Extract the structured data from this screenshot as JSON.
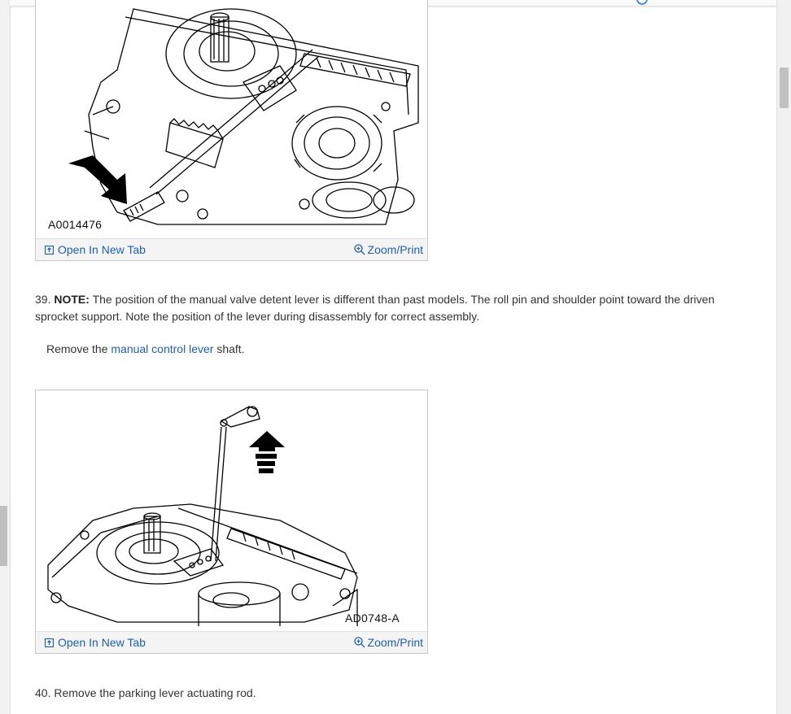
{
  "figures": [
    {
      "label": "A0014476",
      "open_link": "Open In New Tab",
      "zoom_link": "Zoom/Print"
    },
    {
      "label": "AD0748-A",
      "open_link": "Open In New Tab",
      "zoom_link": "Zoom/Print"
    }
  ],
  "step39": {
    "number": "39.",
    "note_label": "NOTE:",
    "note_text": "The position of the manual valve detent lever is different than past models. The roll pin and shoulder point toward the driven sprocket support. Note the position of the lever during disassembly for correct assembly.",
    "remove_prefix": "Remove the",
    "remove_link": "manual control lever",
    "remove_suffix": "shaft."
  },
  "step40": {
    "text": "40. Remove the parking lever actuating rod."
  },
  "icons": {
    "open": "open-in-new-tab-icon",
    "zoom": "zoom-magnifier-icon"
  },
  "colors": {
    "link": "#1f5fa8",
    "text": "#333333"
  }
}
